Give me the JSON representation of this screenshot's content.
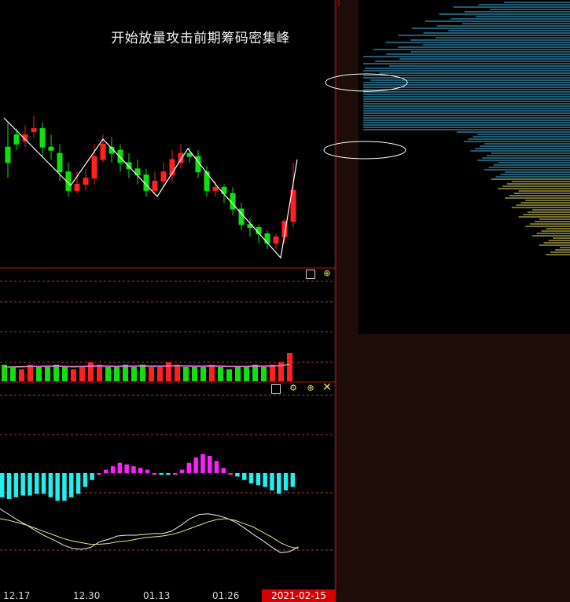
{
  "annotation": "开始放量攻击前期筹码密集峰",
  "xaxis": {
    "labels": [
      "12.17",
      "12.30",
      "01.13",
      "01.26"
    ]
  },
  "cursor_date": "2021-02-15",
  "icons": {
    "price_panel": [
      "window-icon",
      "zoom-icon"
    ],
    "volume_panel": [
      "window-icon",
      "settings-icon",
      "zoom-icon",
      "close-icon"
    ]
  },
  "colors": {
    "up": "#ff2020",
    "down": "#10e010",
    "macd_pos": "#ff20ff",
    "macd_neg": "#20f0f0",
    "chip_blue": "#3fb8e8",
    "chip_yellow": "#e8e060",
    "sidebar": "#1e0c08"
  },
  "candles": [
    [
      100,
      95,
      108,
      90
    ],
    [
      104,
      101,
      106,
      99
    ],
    [
      102,
      104,
      107,
      100
    ],
    [
      105,
      106,
      110,
      103
    ],
    [
      106,
      100,
      108,
      97
    ],
    [
      100,
      99,
      104,
      96
    ],
    [
      98,
      92,
      101,
      89
    ],
    [
      92,
      86,
      95,
      84
    ],
    [
      86,
      88,
      92,
      85
    ],
    [
      88,
      90,
      93,
      86
    ],
    [
      90,
      97,
      101,
      88
    ],
    [
      96,
      101,
      104,
      95
    ],
    [
      100,
      98,
      103,
      95
    ],
    [
      99,
      95,
      101,
      92
    ],
    [
      95,
      93,
      98,
      90
    ],
    [
      93,
      91,
      96,
      88
    ],
    [
      91,
      86,
      93,
      84
    ],
    [
      86,
      89,
      92,
      85
    ],
    [
      89,
      92,
      95,
      87
    ],
    [
      91,
      96,
      99,
      89
    ],
    [
      95,
      98,
      101,
      93
    ],
    [
      98,
      97,
      100,
      95
    ],
    [
      97,
      92,
      99,
      90
    ],
    [
      92,
      86,
      94,
      84
    ],
    [
      86,
      87,
      89,
      84
    ],
    [
      87,
      85,
      88,
      82
    ],
    [
      85,
      80,
      87,
      78
    ],
    [
      80,
      75,
      82,
      73
    ],
    [
      75,
      74,
      77,
      71
    ],
    [
      74,
      72,
      75,
      69
    ],
    [
      72,
      69,
      73,
      67
    ],
    [
      69,
      71,
      72,
      67
    ],
    [
      71,
      76,
      77,
      69
    ],
    [
      76,
      86,
      95,
      74
    ]
  ],
  "volume": [
    7,
    6,
    5,
    7,
    6,
    6,
    7,
    6,
    5,
    6,
    8,
    7,
    6,
    6,
    7,
    6,
    7,
    6,
    6,
    8,
    7,
    6,
    6,
    6,
    7,
    6,
    5,
    6,
    6,
    7,
    6,
    7,
    8,
    12
  ],
  "volume_ma": [
    6,
    6.1,
    6.2,
    6.3,
    6.3,
    6.4,
    6.4,
    6.3,
    6.2,
    6.3,
    6.4,
    6.5,
    6.4,
    6.3,
    6.4,
    6.4,
    6.5,
    6.4,
    6.4,
    6.5,
    6.6,
    6.5,
    6.4,
    6.4,
    6.5,
    6.4,
    6.3,
    6.3,
    6.3,
    6.4,
    6.4,
    6.5,
    6.6,
    7.2
  ],
  "macd_hist": [
    -7,
    -7.5,
    -7,
    -6.5,
    -6.5,
    -6,
    -6,
    -7,
    -8,
    -8,
    -7,
    -6,
    -4,
    -2,
    0,
    1,
    2,
    3,
    2.5,
    2,
    1.5,
    1,
    0,
    -0.5,
    -0.5,
    0,
    1,
    3,
    4.5,
    5.5,
    5,
    3.5,
    1.5,
    0,
    -1,
    -2,
    -3,
    -3.5,
    -4,
    -5,
    -6,
    -5,
    -4
  ],
  "dif": [
    12,
    5,
    -2,
    -8,
    -15,
    -21,
    -26,
    -32,
    -36,
    -37,
    -35,
    -28,
    -25,
    -21,
    -20,
    -20,
    -19,
    -18,
    -18,
    -15,
    -8,
    0,
    5,
    6,
    4,
    1,
    -4,
    -11,
    -19,
    -26,
    -34,
    -41,
    -40,
    -34
  ],
  "dea": [
    0,
    -2,
    -5,
    -8,
    -12,
    -16,
    -20,
    -24,
    -27,
    -29,
    -31,
    -31,
    -30,
    -28,
    -27,
    -25,
    -23,
    -22,
    -21,
    -19,
    -16,
    -12,
    -8,
    -4,
    -1,
    0,
    -2,
    -6,
    -10,
    -16,
    -22,
    -29,
    -34,
    -36
  ],
  "chip_profile": [
    {
      "top": 0.02,
      "bottom": 0.16,
      "color": "blue"
    },
    {
      "top": 0.16,
      "bottom": 0.49,
      "color": "blue"
    },
    {
      "top": 0.49,
      "bottom": 0.58,
      "color": "yellow"
    },
    {
      "top": 0.58,
      "bottom": 0.78,
      "color": "yellow"
    }
  ]
}
